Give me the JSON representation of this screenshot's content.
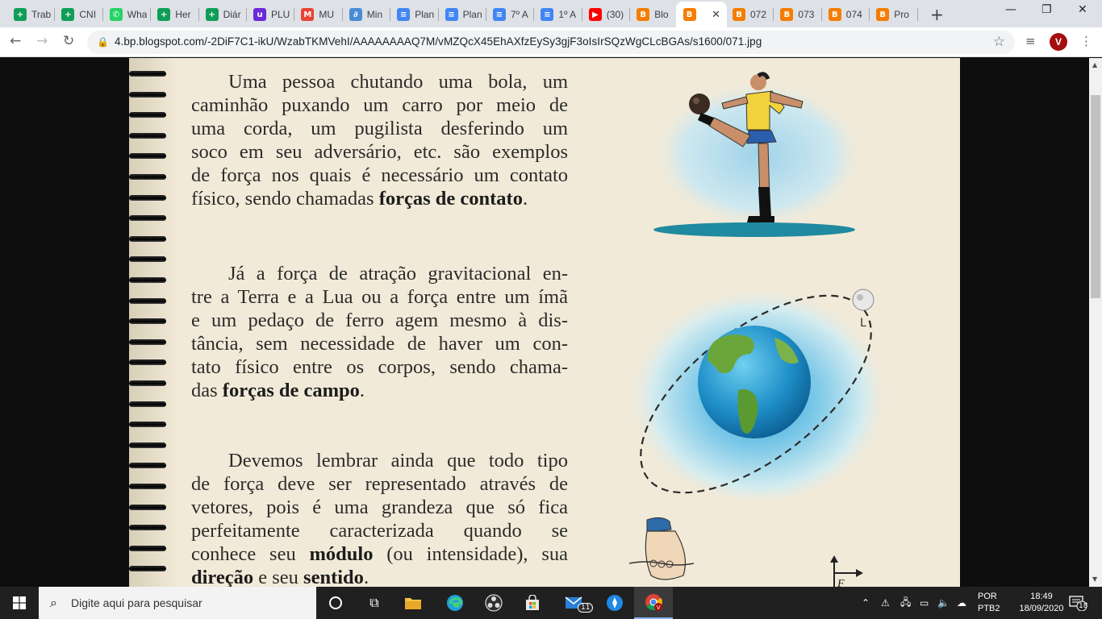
{
  "browser": {
    "tabs": [
      {
        "label": "Trab",
        "icon": "google-sheets-icon",
        "color": "#0f9d58",
        "glyph": "+"
      },
      {
        "label": "CNI",
        "icon": "google-sheets-icon",
        "color": "#0f9d58",
        "glyph": "+"
      },
      {
        "label": "Wha",
        "icon": "whatsapp-icon",
        "color": "#25d366",
        "glyph": "✆"
      },
      {
        "label": "Her",
        "icon": "google-sheets-icon",
        "color": "#0f9d58",
        "glyph": "+"
      },
      {
        "label": "Diár",
        "icon": "google-sheets-icon",
        "color": "#0f9d58",
        "glyph": "+"
      },
      {
        "label": "PLU",
        "icon": "plurall-icon",
        "color": "#6a2ad8",
        "glyph": "u"
      },
      {
        "label": "MU",
        "icon": "gmail-icon",
        "color": "#ea4335",
        "glyph": "M"
      },
      {
        "label": "Min",
        "icon": "drive-icon",
        "color": "#4a8bd6",
        "glyph": "∂"
      },
      {
        "label": "Plan",
        "icon": "google-docs-icon",
        "color": "#4285f4",
        "glyph": "≡"
      },
      {
        "label": "Plan",
        "icon": "google-docs-icon",
        "color": "#4285f4",
        "glyph": "≡"
      },
      {
        "label": "7º A",
        "icon": "google-docs-icon",
        "color": "#4285f4",
        "glyph": "≡"
      },
      {
        "label": "1º A",
        "icon": "google-docs-icon",
        "color": "#4285f4",
        "glyph": "≡"
      },
      {
        "label": "(30)",
        "icon": "youtube-icon",
        "color": "#ff0000",
        "glyph": "▶"
      },
      {
        "label": "Blo",
        "icon": "blogger-icon",
        "color": "#f57d00",
        "glyph": "B"
      },
      {
        "label": "",
        "icon": "blogger-icon",
        "color": "#f57d00",
        "glyph": "B",
        "active": true,
        "close": "✕"
      },
      {
        "label": "072",
        "icon": "blogger-icon",
        "color": "#f57d00",
        "glyph": "B"
      },
      {
        "label": "073",
        "icon": "blogger-icon",
        "color": "#f57d00",
        "glyph": "B"
      },
      {
        "label": "074",
        "icon": "blogger-icon",
        "color": "#f57d00",
        "glyph": "B"
      },
      {
        "label": "Pro",
        "icon": "blogger-icon",
        "color": "#f57d00",
        "glyph": "B"
      }
    ],
    "new_tab": "+",
    "window_controls": {
      "minimize": "—",
      "restore": "❐",
      "close": "✕"
    },
    "nav": {
      "back": "←",
      "forward": "→",
      "reload": "↻"
    },
    "url": "4.bp.blogspot.com/-2DiF7C1-ikU/WzabTKMVehI/AAAAAAAAQ7M/vMZQcX45EhAXfzEySy3gjF3oIsIrSQzWgCLcBGAs/s1600/071.jpg",
    "lock_icon": "🔒",
    "star_icon": "☆",
    "media_icon": "≡",
    "profile_initial": "V"
  },
  "page": {
    "paragraphs": [
      {
        "lines": [
          [
            {
              "t": "Uma pessoa chutando uma bola, um"
            }
          ],
          [
            {
              "t": "caminhão puxando um carro por meio de"
            }
          ],
          [
            {
              "t": "uma corda, um pugilista desferindo um"
            }
          ],
          [
            {
              "t": "soco em seu adversário, etc. são exemplos"
            }
          ],
          [
            {
              "t": "de força nos quais é necessário um contato"
            }
          ],
          [
            {
              "t": "físico, sendo chamadas "
            },
            {
              "t": "forças de contato",
              "b": true
            },
            {
              "t": "."
            }
          ]
        ]
      },
      {
        "lines": [
          [
            {
              "t": "Já a força de atração gravitacional en-"
            }
          ],
          [
            {
              "t": "tre a Terra e a Lua ou a força entre um ímã"
            }
          ],
          [
            {
              "t": "e um pedaço de ferro agem mesmo à dis-"
            }
          ],
          [
            {
              "t": "tância, sem necessidade de haver um con-"
            }
          ],
          [
            {
              "t": "tato físico entre os corpos, sendo chama-"
            }
          ],
          [
            {
              "t": "das "
            },
            {
              "t": "forças de campo",
              "b": true
            },
            {
              "t": "."
            }
          ]
        ]
      },
      {
        "lines": [
          [
            {
              "t": "Devemos lembrar ainda que todo tipo"
            }
          ],
          [
            {
              "t": "de força deve ser representado através de"
            }
          ],
          [
            {
              "t": "vetores, pois é uma grandeza que só fica"
            }
          ],
          [
            {
              "t": "perfeitamente caracterizada quando se"
            }
          ],
          [
            {
              "t": "conhece seu "
            },
            {
              "t": "módulo",
              "b": true
            },
            {
              "t": " (ou intensidade), sua"
            }
          ],
          [
            {
              "t": "direção",
              "b": true
            },
            {
              "t": " e seu "
            },
            {
              "t": "sentido",
              "b": true
            },
            {
              "t": "."
            }
          ]
        ]
      }
    ],
    "moon_label": "L",
    "vector_label": "F"
  },
  "taskbar": {
    "search_placeholder": "Digite aqui para pesquisar",
    "mail_badge": "11",
    "language": "POR",
    "layout": "PTB2",
    "time": "18:49",
    "date": "18/09/2020",
    "notifications": "18"
  }
}
